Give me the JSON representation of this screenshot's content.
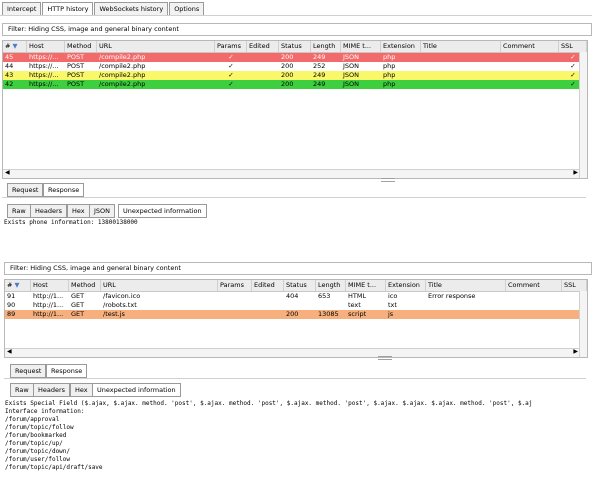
{
  "tabs": [
    "Intercept",
    "HTTP history",
    "WebSockets history",
    "Options"
  ],
  "active_tab": 1,
  "panel1": {
    "filter": "Filter: Hiding CSS, image and general binary content",
    "columns": [
      "#",
      "Host",
      "Method",
      "URL",
      "Params",
      "Edited",
      "Status",
      "Length",
      "MIME t...",
      "Extension",
      "Title",
      "Comment",
      "SSL"
    ],
    "rows": [
      {
        "num": "45",
        "host": "https://...",
        "method": "POST",
        "url": "/compile2.php",
        "params": "✓",
        "edited": "",
        "status": "200",
        "length": "249",
        "mime": "JSON",
        "ext": "php",
        "title": "",
        "comment": "",
        "ssl": "✓",
        "bg": "#f26a6a",
        "fg": "#ffffff"
      },
      {
        "num": "44",
        "host": "https://...",
        "method": "POST",
        "url": "/compile2.php",
        "params": "✓",
        "edited": "",
        "status": "200",
        "length": "252",
        "mime": "JSON",
        "ext": "php",
        "title": "",
        "comment": "",
        "ssl": "✓",
        "bg": "#ffffff",
        "fg": "#000000"
      },
      {
        "num": "43",
        "host": "https://...",
        "method": "POST",
        "url": "/compile2.php",
        "params": "✓",
        "edited": "",
        "status": "200",
        "length": "249",
        "mime": "JSON",
        "ext": "php",
        "title": "",
        "comment": "",
        "ssl": "✓",
        "bg": "#f8f86a",
        "fg": "#000000"
      },
      {
        "num": "42",
        "host": "https://...",
        "method": "POST",
        "url": "/compile2.php",
        "params": "✓",
        "edited": "",
        "status": "200",
        "length": "249",
        "mime": "JSON",
        "ext": "php",
        "title": "",
        "comment": "",
        "ssl": "✓",
        "bg": "#3ecf3e",
        "fg": "#000000"
      }
    ],
    "reqres": [
      "Request",
      "Response"
    ],
    "viewtabs": [
      "Raw",
      "Headers",
      "Hex",
      "JSON",
      "Unexpected information"
    ],
    "output": "Exists phone information: 13800138000"
  },
  "panel2": {
    "filter": "Filter: Hiding CSS, image and general binary content",
    "columns": [
      "#",
      "Host",
      "Method",
      "URL",
      "Params",
      "Edited",
      "Status",
      "Length",
      "MIME t...",
      "Extension",
      "Title",
      "Comment",
      "SSL"
    ],
    "rows": [
      {
        "num": "91",
        "host": "http://1...",
        "method": "GET",
        "url": "/favicon.ico",
        "params": "",
        "edited": "",
        "status": "404",
        "length": "653",
        "mime": "HTML",
        "ext": "ico",
        "title": "Error response",
        "comment": "",
        "ssl": "",
        "bg": "#ffffff",
        "fg": "#000000"
      },
      {
        "num": "90",
        "host": "http://1...",
        "method": "GET",
        "url": "/robots.txt",
        "params": "",
        "edited": "",
        "status": "",
        "length": "",
        "mime": "text",
        "ext": "txt",
        "title": "",
        "comment": "",
        "ssl": "",
        "bg": "#ffffff",
        "fg": "#000000"
      },
      {
        "num": "89",
        "host": "http://1...",
        "method": "GET",
        "url": "/test.js",
        "params": "",
        "edited": "",
        "status": "200",
        "length": "13085",
        "mime": "script",
        "ext": "js",
        "title": "",
        "comment": "",
        "ssl": "",
        "bg": "#f7b07d",
        "fg": "#000000"
      }
    ],
    "reqres": [
      "Request",
      "Response"
    ],
    "viewtabs": [
      "Raw",
      "Headers",
      "Hex",
      "Unexpected information"
    ],
    "output": [
      "Exists Special Field ($.ajax, $.ajax. method. 'post', $.ajax. method. 'post', $.ajax. method. 'post', $.ajax. $.ajax. $.ajax. method. 'post', $.aj",
      "",
      "Interface information:",
      "/forum/approval",
      "/forum/topic/follow",
      "/forum/bookmarked",
      "/forum/topic/up/",
      "/forum/topic/down/",
      "/forum/user/follow",
      "/forum/topic/api/draft/save"
    ]
  }
}
